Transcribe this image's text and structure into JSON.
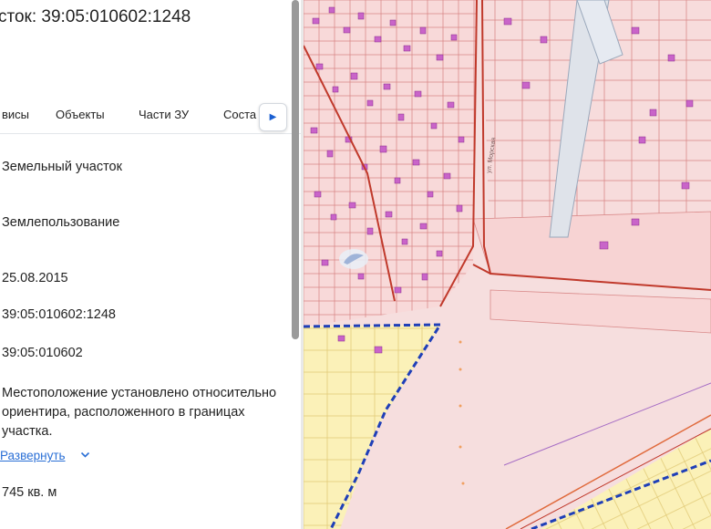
{
  "panel": {
    "title": "сток: 39:05:010602:1248",
    "tabs": [
      {
        "label": "висы"
      },
      {
        "label": "Объекты"
      },
      {
        "label": "Части ЗУ"
      },
      {
        "label": "Соста"
      }
    ],
    "tab_scroll_icon": "chevron-right-icon",
    "values": {
      "type": "Земельный участок",
      "category": "Землепользование",
      "date": "25.08.2015",
      "cadastral_number": "39:05:010602:1248",
      "cadastral_quarter": "39:05:010602",
      "location": "Местоположение установлено относительно ориентира, расположенного в границах участка.",
      "expand_label": "Развернуть",
      "area": "745 кв. м"
    }
  },
  "map": {
    "street_label": "ул. Морская",
    "colors": {
      "background": "#f6dede",
      "parcel_fill": "#f8d9d9",
      "parcel_stroke": "#d97b7b",
      "main_line": "#c0392b",
      "building": "#c964c9",
      "yellow_zone": "#fbf1b8",
      "selected_border": "#1f3fb8",
      "road": "#9aa8bb"
    }
  }
}
